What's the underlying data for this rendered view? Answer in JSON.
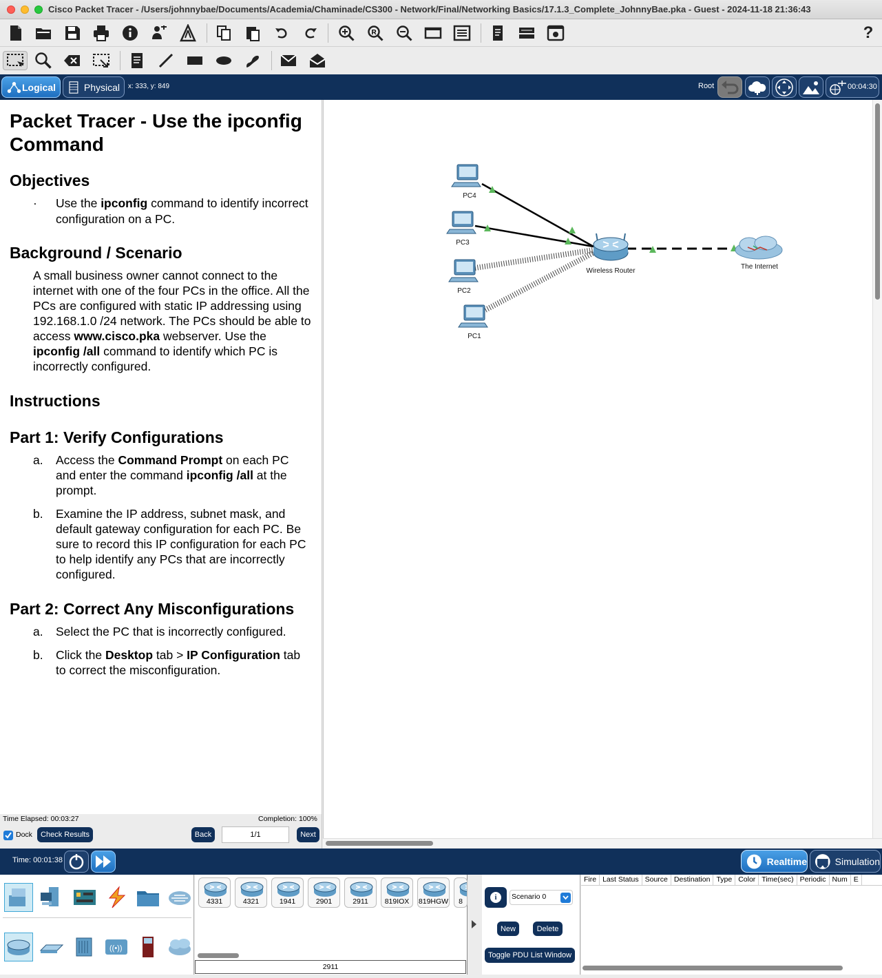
{
  "window": {
    "title": "Cisco Packet Tracer - /Users/johnnybae/Documents/Academia/Chaminade/CS300 - Network/Final/Networking Basics/17.1.3_Complete_JohnnyBae.pka - Guest - 2024-11-18 21:36:43"
  },
  "toolbar": {
    "help_label": "?"
  },
  "nav": {
    "logical_label": "Logical",
    "physical_label": "Physical",
    "coords": "x: 333, y: 849",
    "root_label": "Root",
    "time": "00:04:30"
  },
  "instructions": {
    "title": "Packet Tracer - Use the ipconfig Command",
    "objectives_heading": "Objectives",
    "objective_bullet": "·",
    "objective_pre": "Use the ",
    "objective_bold": "ipconfig",
    "objective_post": " command to identify incorrect configuration on a PC.",
    "background_heading": "Background / Scenario",
    "bg_1": "A small business owner cannot connect to the internet with one of the four PCs in the office. All the PCs are configured with static IP addressing using 192.168.1.0 /24 network. The PCs should be able to access ",
    "bg_bold1": "www.cisco.pka",
    "bg_2": " webserver. Use the ",
    "bg_bold2": "ipconfig /all",
    "bg_3": " command to identify which PC is incorrectly configured.",
    "instructions_heading": "Instructions",
    "part1_heading": "Part 1: Verify Configurations",
    "p1a_mark": "a.",
    "p1a_1": "Access the ",
    "p1a_bold1": "Command Prompt",
    "p1a_2": " on each PC and enter the command ",
    "p1a_bold2": "ipconfig /all",
    "p1a_3": " at the prompt.",
    "p1b_mark": "b.",
    "p1b": "Examine the IP address, subnet mask, and default gateway configuration for each PC. Be sure to record this IP configuration for each PC to help identify any PCs that are incorrectly configured.",
    "part2_heading": "Part 2: Correct Any Misconfigurations",
    "p2a_mark": "a.",
    "p2a": "Select the PC that is incorrectly configured.",
    "p2b_mark": "b.",
    "p2b_1": "Click the ",
    "p2b_bold1": "Desktop",
    "p2b_2": " tab > ",
    "p2b_bold2": "IP Configuration",
    "p2b_3": " tab to correct the misconfiguration."
  },
  "activity": {
    "time_elapsed": "Time Elapsed: 00:03:27",
    "completion": "Completion: 100%",
    "dock_label": "Dock",
    "dock_checked": true,
    "check_results_label": "Check Results",
    "back_label": "Back",
    "page": "1/1",
    "next_label": "Next"
  },
  "topology": {
    "nodes": {
      "pc4": "PC4",
      "pc3": "PC3",
      "pc2": "PC2",
      "pc1": "PC1",
      "router": "Wireless Router",
      "internet": "The Internet"
    },
    "link_color": "#000000",
    "status_color": "#5cb85c"
  },
  "simbar": {
    "time": "Time: 00:01:38",
    "realtime_label": "Realtime",
    "simulation_label": "Simulation"
  },
  "devices": {
    "models": [
      "4331",
      "4321",
      "1941",
      "2901",
      "2911",
      "819IOX",
      "819HGW",
      "8"
    ],
    "selected_model": "2911"
  },
  "scenario": {
    "selected": "Scenario 0",
    "info_icon": "i",
    "new_label": "New",
    "delete_label": "Delete",
    "toggle_label": "Toggle PDU List Window"
  },
  "pdu_table": {
    "columns": [
      "Fire",
      "Last Status",
      "Source",
      "Destination",
      "Type",
      "Color",
      "Time(sec)",
      "Periodic",
      "Num",
      "E"
    ]
  }
}
